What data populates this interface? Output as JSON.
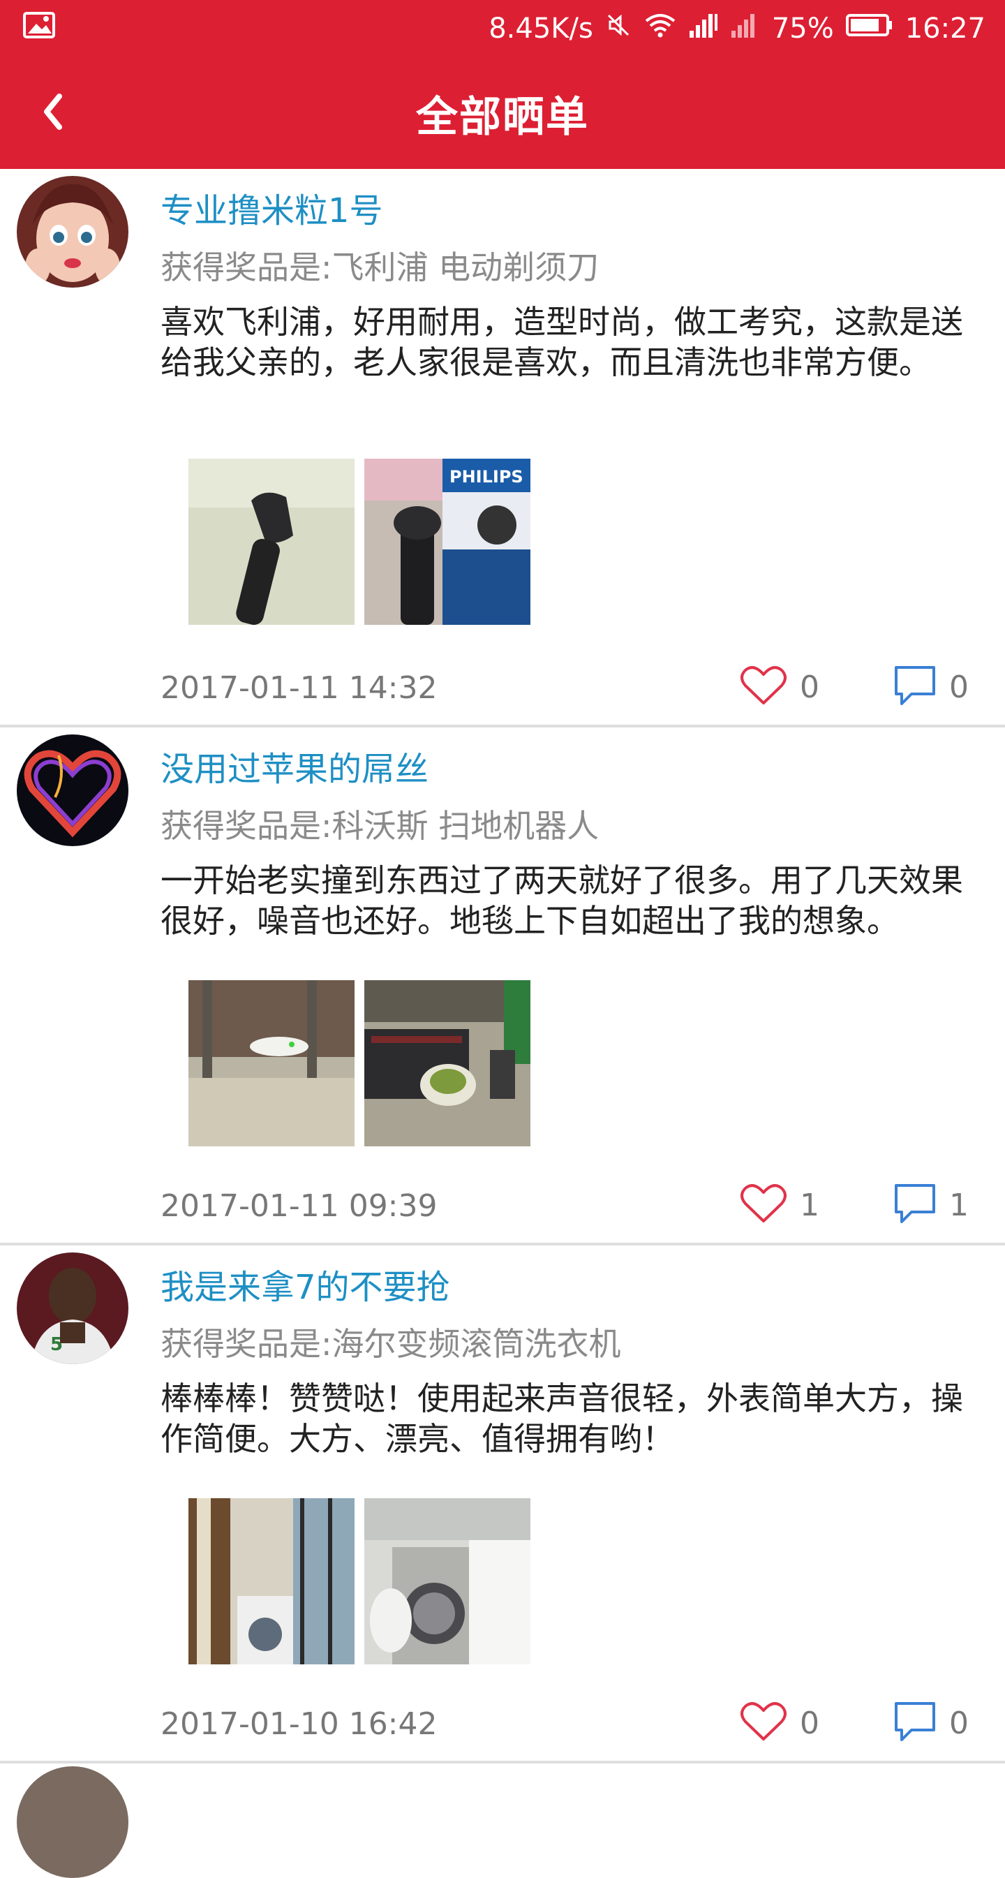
{
  "status_bar": {
    "speed": "8.45K/s",
    "battery": "75%",
    "time": "16:27",
    "icons": [
      "image-icon",
      "mute-icon",
      "wifi-icon",
      "signal-icon",
      "signal-off-icon",
      "battery-icon"
    ]
  },
  "header": {
    "title": "全部晒单",
    "back_icon": "chevron-left-icon"
  },
  "colors": {
    "brand_red": "#dd1f33",
    "username_blue": "#1e8fc4",
    "like_red": "#e0334a",
    "comment_blue": "#3a7fd5"
  },
  "posts": [
    {
      "username": "专业撸米粒1号",
      "prize": "获得奖品是:飞利浦 电动剃须刀",
      "content": "喜欢飞利浦，好用耐用，造型时尚，做工考究，这款是送给我父亲的，老人家很是喜欢，而且清洗也非常方便。",
      "date": "2017-01-11 14:32",
      "likes": "0",
      "comments": "0",
      "photos": [
        {
          "alt": "shaver-photo",
          "label": ""
        },
        {
          "alt": "philips-box-photo",
          "label": "PHILIPS"
        }
      ]
    },
    {
      "username": "没用过苹果的屌丝",
      "prize": "获得奖品是:科沃斯 扫地机器人",
      "content": "一开始老实撞到东西过了两天就好了很多。用了几天效果很好，噪音也还好。地毯上下自如超出了我的想象。",
      "date": "2017-01-11 09:39",
      "likes": "1",
      "comments": "1",
      "photos": [
        {
          "alt": "robot-vacuum-photo-1",
          "label": ""
        },
        {
          "alt": "robot-vacuum-photo-2",
          "label": ""
        }
      ]
    },
    {
      "username": "我是来拿7的不要抢",
      "prize": "获得奖品是:海尔变频滚筒洗衣机",
      "content": "棒棒棒！赞赞哒！使用起来声音很轻，外表简单大方，操作简便。大方、漂亮、值得拥有哟！",
      "date": "2017-01-10 16:42",
      "likes": "0",
      "comments": "0",
      "photos": [
        {
          "alt": "washer-photo-1",
          "label": ""
        },
        {
          "alt": "washer-photo-2",
          "label": ""
        }
      ]
    }
  ]
}
